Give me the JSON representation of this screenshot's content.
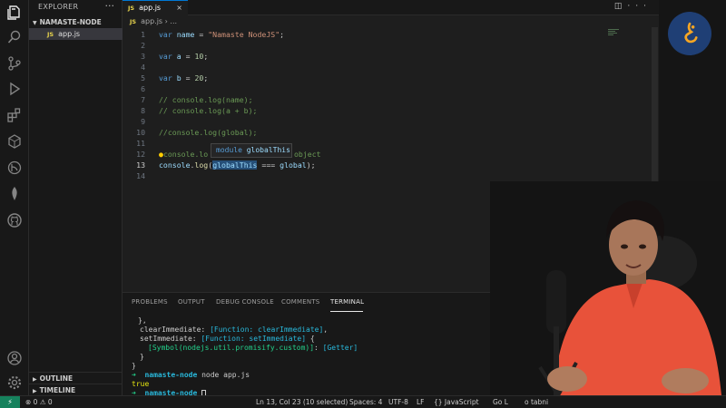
{
  "explorer": {
    "title": "EXPLORER",
    "folder": "NAMASTE-NODE",
    "file": "app.js",
    "file_badge": "JS",
    "outline": "OUTLINE",
    "timeline": "TIMELINE"
  },
  "tab": {
    "label": "app.js",
    "badge": "JS",
    "close": "×"
  },
  "breadcrumb": {
    "file": "app.js",
    "sep": " › ..."
  },
  "editor": {
    "lines": [
      {
        "n": "1"
      },
      {
        "n": "2"
      },
      {
        "n": "3"
      },
      {
        "n": "4"
      },
      {
        "n": "5"
      },
      {
        "n": "6"
      },
      {
        "n": "7"
      },
      {
        "n": "8"
      },
      {
        "n": "9"
      },
      {
        "n": "10"
      },
      {
        "n": "11"
      },
      {
        "n": "12"
      },
      {
        "n": "13"
      },
      {
        "n": "14"
      }
    ],
    "code": {
      "l1_kw": "var",
      "l1_var": "name",
      "l1_eq": " = ",
      "l1_str": "\"Namaste NodeJS\"",
      "l1_end": ";",
      "l3_kw": "var",
      "l3_var": "a",
      "l3_eq": " = ",
      "l3_num": "10",
      "l3_end": ";",
      "l5_kw": "var",
      "l5_var": "b",
      "l5_eq": " = ",
      "l5_num": "20",
      "l5_end": ";",
      "l7": "// console.log(name);",
      "l8": "// console.log(a + b);",
      "l10": "//console.log(global);",
      "l12_a": "console.lo",
      "l12_b": "object",
      "l13_obj": "console",
      "l13_dot": ".",
      "l13_fn": "log",
      "l13_open": "(",
      "l13_sel": "globalThis",
      "l13_op": " === ",
      "l13_var": "global",
      "l13_end": ");"
    },
    "hover": {
      "kw": "module",
      "name": "globalThis"
    }
  },
  "panel": {
    "tabs": [
      "PROBLEMS",
      "OUTPUT",
      "DEBUG CONSOLE",
      "COMMENTS",
      "TERMINAL"
    ],
    "terminal": {
      "l1": "},",
      "l2_key": "clearImmediate: ",
      "l2_val": "[Function: clearImmediate]",
      "l2_end": ",",
      "l3_key": "setImmediate: ",
      "l3_val": "[Function: setImmediate]",
      "l3_end": " {",
      "l4_val": "[Symbol(nodejs.util.promisify.custom)]",
      "l4_key": ": ",
      "l4_get": "[Getter]",
      "l5": "}",
      "l6": "}",
      "prompt_dir": "namaste-node",
      "command": " node app.js",
      "result": "true",
      "arrow": "➜"
    }
  },
  "statusbar": {
    "remote": "⚡",
    "problems": "⊗ 0 ⚠ 0",
    "position": "Ln 13, Col 23 (10 selected)",
    "spaces": "Spaces: 4",
    "encoding": "UTF-8",
    "eol": "LF",
    "language": "{} JavaScript",
    "golive": "Go L",
    "tabnine": "o tabni"
  },
  "colors": {
    "accent": "#0078d4",
    "remote": "#16825d"
  }
}
